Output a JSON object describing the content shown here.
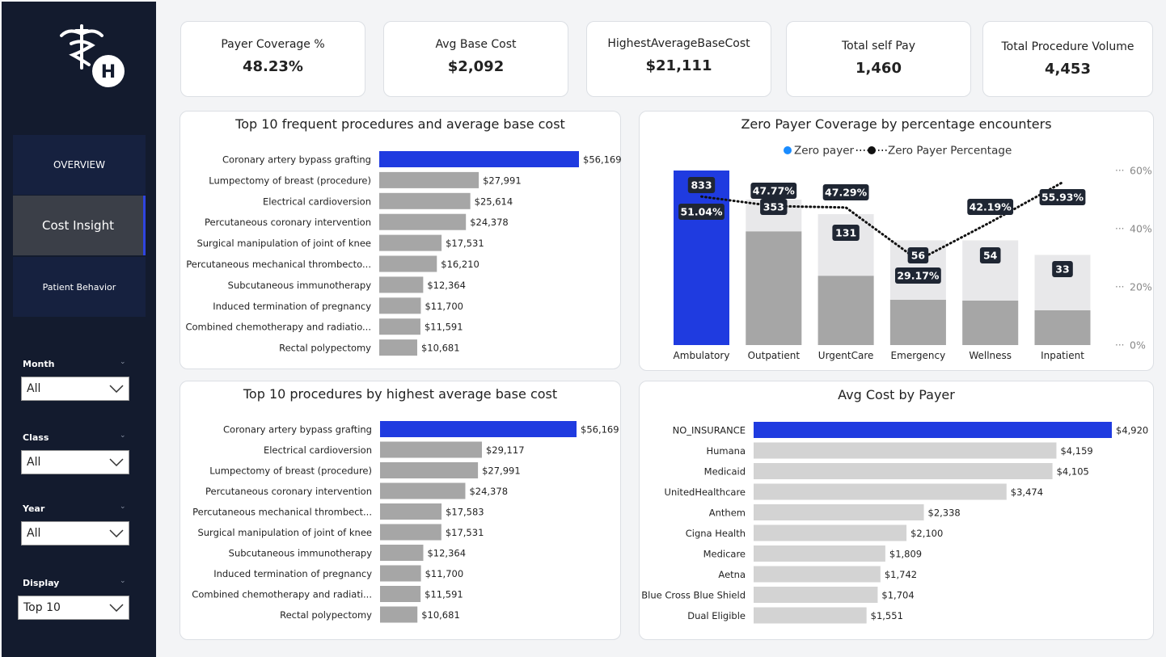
{
  "sidebar": {
    "logo_letter": "H",
    "nav": [
      {
        "label": "OVERVIEW"
      },
      {
        "label": "Cost Insight"
      },
      {
        "label": "Patient Behavior"
      }
    ],
    "filters": [
      {
        "label": "Month",
        "value": "All"
      },
      {
        "label": "Class",
        "value": "All"
      },
      {
        "label": "Year",
        "value": "All"
      },
      {
        "label": "Display",
        "value": "Top 10"
      }
    ]
  },
  "kpis": [
    {
      "label": "Payer Coverage %",
      "value": "48.23%"
    },
    {
      "label": "Avg Base Cost",
      "value": "$2,092"
    },
    {
      "label": "HighestAverageBaseCost",
      "value": "$21,111"
    },
    {
      "label": "Total self Pay",
      "value": "1,460"
    },
    {
      "label": "Total Procedure Volume",
      "value": "4,453"
    }
  ],
  "colors": {
    "accent": "#1f3be0",
    "bar_gray": "#a6a6a6",
    "bar_light": "#d3d3d3",
    "label_bg": "#1f2633"
  },
  "chart_data": [
    {
      "type": "bar",
      "orientation": "horizontal",
      "title": "Top 10 frequent procedures and average base cost",
      "categories": [
        "Coronary artery bypass grafting",
        "Lumpectomy of breast (procedure)",
        "Electrical cardioversion",
        "Percutaneous coronary intervention",
        "Surgical manipulation of joint of knee",
        "Percutaneous mechanical thrombecto...",
        "Subcutaneous immunotherapy",
        "Induced termination of pregnancy",
        "Combined chemotherapy and radiatio...",
        "Rectal polypectomy"
      ],
      "values": [
        56169,
        27991,
        25614,
        24378,
        17531,
        16210,
        12364,
        11700,
        11591,
        10681
      ],
      "labels": [
        "$56,169",
        "$27,991",
        "$25,614",
        "$24,378",
        "$17,531",
        "$16,210",
        "$12,364",
        "$11,700",
        "$11,591",
        "$10,681"
      ]
    },
    {
      "type": "bar",
      "orientation": "horizontal",
      "title": "Top 10 procedures by highest average base cost",
      "categories": [
        "Coronary artery bypass grafting",
        "Electrical cardioversion",
        "Lumpectomy of breast (procedure)",
        "Percutaneous coronary intervention",
        "Percutaneous mechanical thrombect...",
        "Surgical manipulation of joint of knee",
        "Subcutaneous immunotherapy",
        "Induced termination of pregnancy",
        "Combined chemotherapy and radiati...",
        "Rectal polypectomy"
      ],
      "values": [
        56169,
        29117,
        27991,
        24378,
        17583,
        17531,
        12364,
        11700,
        11591,
        10681
      ],
      "labels": [
        "$56,169",
        "$29,117",
        "$27,991",
        "$24,378",
        "$17,583",
        "$17,531",
        "$12,364",
        "$11,700",
        "$11,591",
        "$10,681"
      ]
    },
    {
      "type": "bar+line",
      "title": "Zero Payer Coverage by percentage encounters",
      "categories": [
        "Ambulatory",
        "Outpatient",
        "UrgentCare",
        "Emergency",
        "Wellness",
        "Inpatient"
      ],
      "series": [
        {
          "name": "Zero payer",
          "values": [
            833,
            353,
            131,
            56,
            54,
            33
          ]
        },
        {
          "name": "Zero Payer Percentage",
          "values": [
            51.04,
            47.77,
            47.29,
            29.17,
            42.19,
            55.93
          ],
          "labels": [
            "51.04%",
            "47.77%",
            "47.29%",
            "29.17%",
            "42.19%",
            "55.93%"
          ]
        }
      ],
      "y2_ticks": [
        "60%",
        "40%",
        "20%",
        "0%"
      ],
      "y2_range": [
        0,
        60
      ],
      "background_bars": [
        60,
        50,
        45,
        36,
        36,
        31
      ]
    },
    {
      "type": "bar",
      "orientation": "horizontal",
      "title": "Avg Cost by Payer",
      "categories": [
        "NO_INSURANCE",
        "Humana",
        "Medicaid",
        "UnitedHealthcare",
        "Anthem",
        "Cigna Health",
        "Medicare",
        "Aetna",
        "Blue Cross Blue Shield",
        "Dual Eligible"
      ],
      "values": [
        4920,
        4159,
        4105,
        3474,
        2338,
        2100,
        1809,
        1742,
        1704,
        1551
      ],
      "labels": [
        "$4,920",
        "$4,159",
        "$4,105",
        "$3,474",
        "$2,338",
        "$2,100",
        "$1,809",
        "$1,742",
        "$1,704",
        "$1,551"
      ]
    }
  ]
}
